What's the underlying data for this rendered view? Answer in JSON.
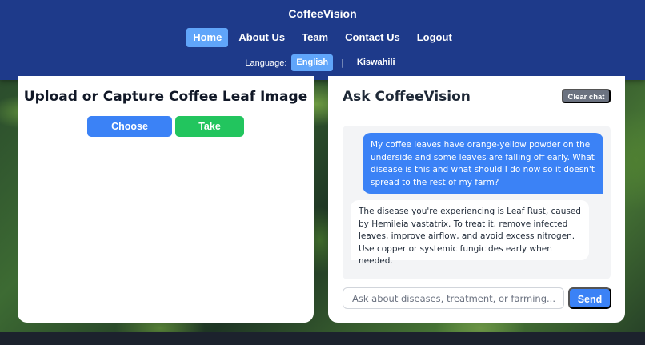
{
  "header": {
    "brand": "CoffeeVision",
    "nav": [
      {
        "label": "Home",
        "active": true
      },
      {
        "label": "About Us",
        "active": false
      },
      {
        "label": "Team",
        "active": false
      },
      {
        "label": "Contact Us",
        "active": false
      },
      {
        "label": "Logout",
        "active": false
      }
    ],
    "language": {
      "label": "Language:",
      "options": [
        "English",
        "Kiswahili"
      ],
      "selected": "English",
      "separator": "|"
    }
  },
  "upload": {
    "title": "Upload or Capture Coffee Leaf Image",
    "choose_label": "Choose Image",
    "photo_label": "Take Photo"
  },
  "chat": {
    "title": "Ask CoffeeVision",
    "clear_label": "Clear chat",
    "messages": [
      {
        "role": "user",
        "text": "My coffee leaves have orange-yellow powder on the underside and some leaves are falling off early. What disease is this and what should I do now so it doesn't spread to the rest of my farm?"
      },
      {
        "role": "assistant",
        "text": "The disease you're experiencing is Leaf Rust, caused by Hemileia vastatrix. To treat it, remove infected leaves, improve airflow, and avoid excess nitrogen. Use copper or systemic fungicides early when needed."
      }
    ],
    "input_value": "",
    "input_placeholder": "Ask about diseases, treatment, or farming...",
    "send_label": "Send"
  },
  "colors": {
    "header_bg": "#1e3a8a",
    "active_tab": "#60a5fa",
    "primary": "#3b82f6",
    "success": "#22c55e",
    "neutral": "#6b7280"
  }
}
